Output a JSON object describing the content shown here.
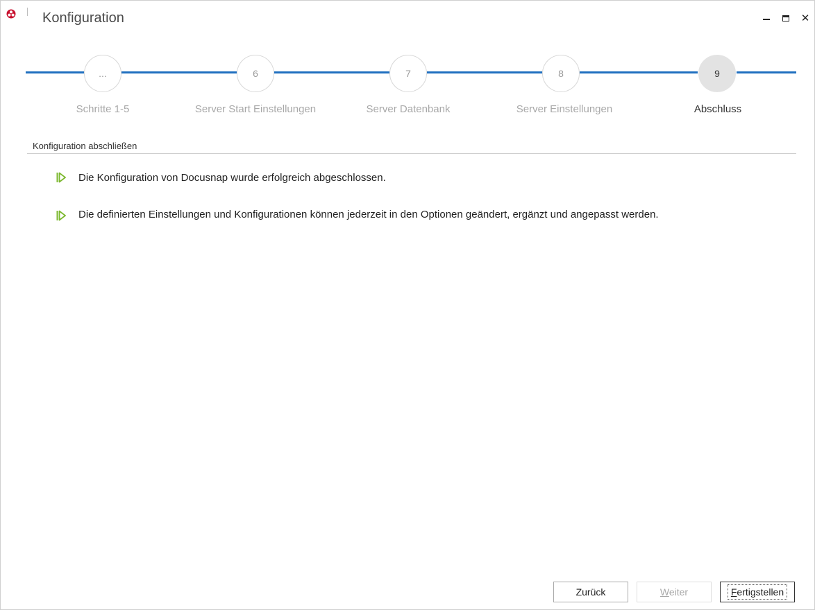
{
  "window": {
    "title": "Konfiguration"
  },
  "stepper": {
    "steps": [
      {
        "number": "...",
        "label": "Schritte 1-5",
        "active": false
      },
      {
        "number": "6",
        "label": "Server Start Einstellungen",
        "active": false
      },
      {
        "number": "7",
        "label": "Server Datenbank",
        "active": false
      },
      {
        "number": "8",
        "label": "Server Einstellungen",
        "active": false
      },
      {
        "number": "9",
        "label": "Abschluss",
        "active": true
      }
    ]
  },
  "section": {
    "title": "Konfiguration abschließen"
  },
  "messages": [
    "Die Konfiguration von Docusnap wurde erfolgreich abgeschlossen.",
    "Die definierten Einstellungen und Konfigurationen können jederzeit in den Optionen geändert, ergänzt und angepasst werden."
  ],
  "buttons": {
    "back": "Zurück",
    "next_mnemonic": "W",
    "next_rest": "eiter",
    "finish_mnemonic": "F",
    "finish_rest": "ertigstellen"
  },
  "colors": {
    "accent_line": "#1f6fbf",
    "success_arrow": "#7cb82f",
    "app_icon": "#c8102e"
  }
}
